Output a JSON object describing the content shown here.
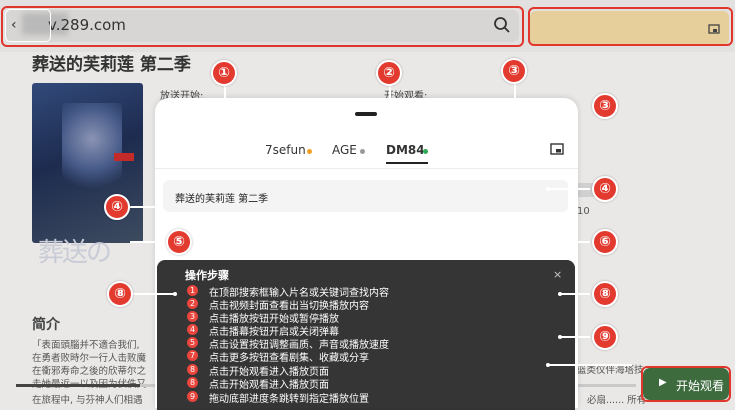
{
  "header": {
    "url_text": "v.289.com",
    "search_icon": "search-icon",
    "right_icon": "cast-icon"
  },
  "page": {
    "title": "葬送的芙莉莲 第二季",
    "poster_text": "葬送の",
    "broadcast_label": "放送开始:",
    "progress_label": "开始观看:",
    "side_number": "10",
    "intro_heading": "简介",
    "intro_lines": [
      "「表面頭腦并不適合我们,",
      "在勇者败時尔一行人击败魔",
      "在衝邪寿命之後的欣蒂尔之",
      "走她最近一以及因为伏佚又",
      "在旅程中, 与芬神人们相遇"
    ],
    "intro_right_a": "篮类仪伴海塔技",
    "intro_right_b": "必扇...... 所有",
    "start_button_label": "开始观看",
    "playback_progress": 0.2
  },
  "sheet": {
    "tabs": [
      {
        "label": "7sefun",
        "dot_color": "#f0a020"
      },
      {
        "label": "AGE",
        "dot_color": "#999999"
      },
      {
        "label": "DM84",
        "dot_color": "#2eaa55"
      }
    ],
    "active_tab": "DM84",
    "anime_title": "葬送的芙莉莲 第二季"
  },
  "steps": {
    "title": "操作步骤",
    "close_label": "×",
    "items": [
      {
        "num": "1",
        "text": "在顶部搜索框输入片名或关键词查找内容"
      },
      {
        "num": "2",
        "text": "点击视频封面查看出当切换播放内容"
      },
      {
        "num": "3",
        "text": "点击播放按钮开始或暂停播放"
      },
      {
        "num": "4",
        "text": "点击播幕按钮开启或关闭弹幕"
      },
      {
        "num": "5",
        "text": "点击设置按钮调整画质、声音或播放速度"
      },
      {
        "num": "7",
        "text": "点击更多按钮查看剧集、收藏或分享"
      },
      {
        "num": "8",
        "text": "点击开始观看进入播放页面"
      },
      {
        "num": "8",
        "text": "点击开始观看进入播放页面"
      },
      {
        "num": "9",
        "text": "拖动底部进度条跳转到指定播放位置"
      }
    ]
  },
  "callouts": [
    {
      "label": "①"
    },
    {
      "label": "②"
    },
    {
      "label": "③"
    },
    {
      "label": "③"
    },
    {
      "label": "④"
    },
    {
      "label": "④"
    },
    {
      "label": "⑤"
    },
    {
      "label": "⑥"
    },
    {
      "label": "⑧"
    },
    {
      "label": "⑧"
    },
    {
      "label": "⑨"
    }
  ]
}
